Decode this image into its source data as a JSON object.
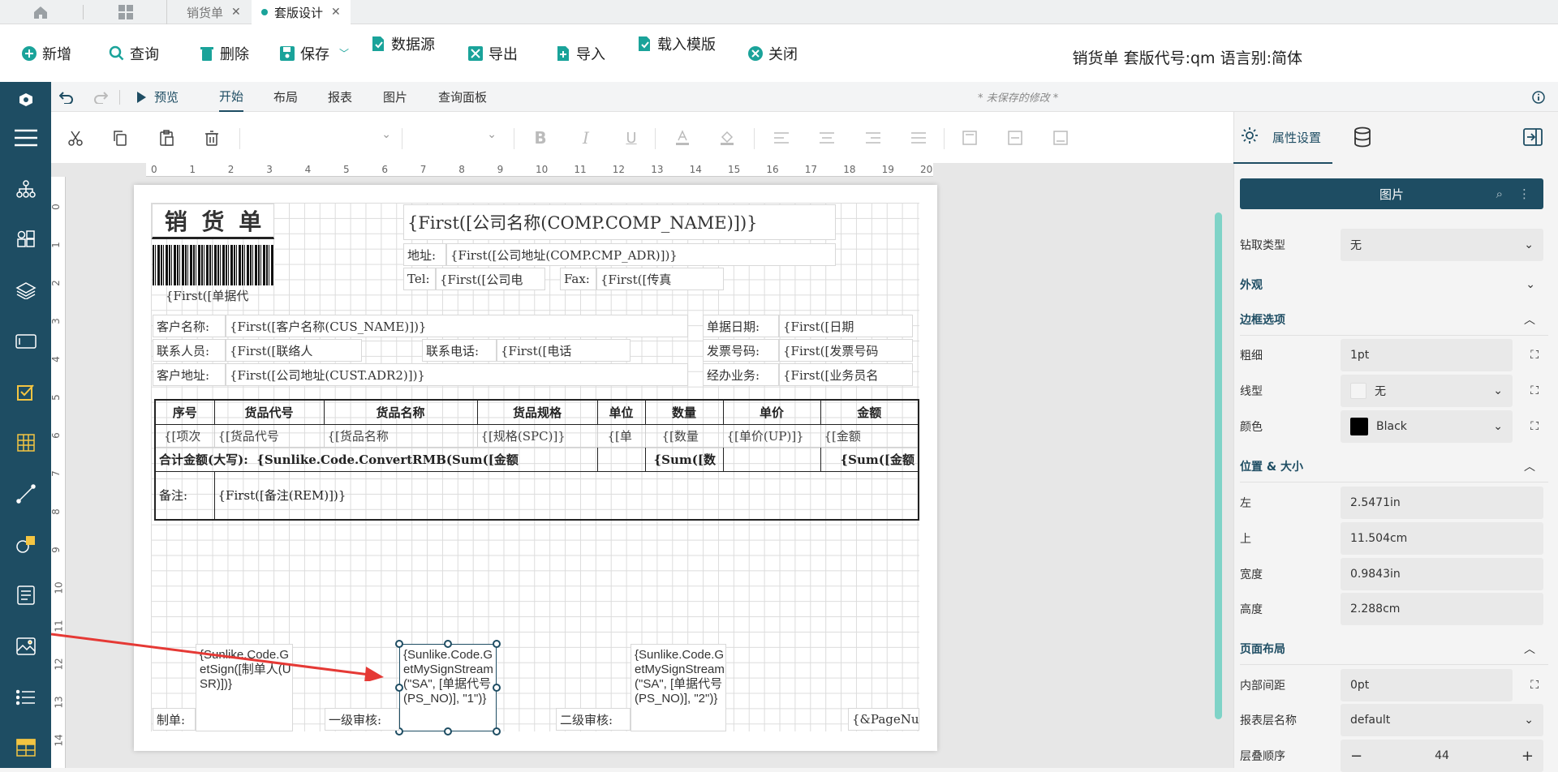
{
  "tabs": {
    "home_icon": "home-icon",
    "grid_icon": "apps-icon",
    "tab1": "销货单",
    "tab2": "套版设计"
  },
  "toolbar": {
    "new": "新增",
    "query": "查询",
    "delete": "删除",
    "save": "保存",
    "datasource": "数据源",
    "export": "导出",
    "import": "导入",
    "load_template": "载入模版",
    "close": "关闭",
    "title": "销货单 套版代号:qm 语言别:简体"
  },
  "ribbon": {
    "preview": "预览",
    "tabs": [
      "开始",
      "布局",
      "报表",
      "图片",
      "查询面板"
    ],
    "unsaved": "* 未保存的修改 *"
  },
  "ruler_h": [
    "0",
    "1",
    "2",
    "3",
    "4",
    "5",
    "6",
    "7",
    "8",
    "9",
    "10",
    "11",
    "12",
    "13",
    "14",
    "15",
    "16",
    "17",
    "18",
    "19",
    "20"
  ],
  "ruler_v": [
    "0",
    "1",
    "2",
    "3",
    "4",
    "5",
    "6",
    "7",
    "8",
    "9",
    "10",
    "11",
    "12",
    "13",
    "14"
  ],
  "report": {
    "title": "销 货 单",
    "doc_no": "{First([单据代",
    "company_name": "{First([公司名称(COMP.COMP_NAME)])}",
    "addr_label": "地址:",
    "addr": "{First([公司地址(COMP.CMP_ADR)])}",
    "tel_label": "Tel:",
    "tel": "{First([公司电",
    "fax_label": "Fax:",
    "fax": "{First([传真",
    "cust_label": "客户名称:",
    "cust": "{First([客户名称(CUS_NAME)])}",
    "contact_label": "联系人员:",
    "contact": "{First([联络人",
    "phone_label": "联系电话:",
    "phone": "{First([电话",
    "caddr_label": "客户地址:",
    "caddr": "{First([公司地址(CUST.ADR2)])}",
    "date_label": "单据日期:",
    "date": "{First([日期",
    "inv_label": "发票号码:",
    "inv": "{First([发票号码",
    "sales_label": "经办业务:",
    "sales": "{First([业务员名",
    "headers": [
      "序号",
      "货品代号",
      "货品名称",
      "货品规格",
      "单位",
      "数量",
      "单价",
      "金额"
    ],
    "row": [
      "{[项次",
      "{[货品代号",
      "{[货品名称",
      "{[规格(SPC)]}",
      "{[单",
      "{[数量",
      "{[单价(UP)]}",
      "{[金额"
    ],
    "total_label": "合计金额(大写):",
    "total_expr": "{Sunlike.Code.ConvertRMB(Sum([金额",
    "sum_qty": "{Sum([数",
    "sum_amt": "{Sum([金额",
    "remark_label": "备注:",
    "remark": "{First([备注(REM)])}",
    "sign1": "{Sunlike.Code.GetSign([制单人(USR)])}",
    "sign2": "{Sunlike.Code.GetMySignStream(\"SA\", [单据代号(PS_NO)], \"1\")}",
    "sign3": "{Sunlike.Code.GetMySignStream(\"SA\", [单据代号(PS_NO)], \"2\")}",
    "maker_label": "制单:",
    "audit1_label": "一级审核:",
    "audit2_label": "二级审核:",
    "page": "{&PageNu"
  },
  "panel": {
    "tab_props": "属性设置",
    "header": "图片",
    "drill_label": "钻取类型",
    "drill": "无",
    "appearance": "外观",
    "border": "边框选项",
    "thick_label": "粗细",
    "thick": "1pt",
    "line_label": "线型",
    "line": "无",
    "color_label": "颜色",
    "color": "Black",
    "pos_size": "位置 & 大小",
    "left_label": "左",
    "left": "2.5471in",
    "top_label": "上",
    "top": "11.504cm",
    "width_label": "宽度",
    "width": "0.9843in",
    "height_label": "高度",
    "height": "2.288cm",
    "layout": "页面布局",
    "padding_label": "内部间距",
    "padding": "0pt",
    "layer_label": "报表层名称",
    "layer": "default",
    "z_label": "层叠顺序",
    "z": "44"
  },
  "colors": {
    "brand": "#1e4d63",
    "accent": "#1aa39a",
    "arrow": "#e53935"
  }
}
